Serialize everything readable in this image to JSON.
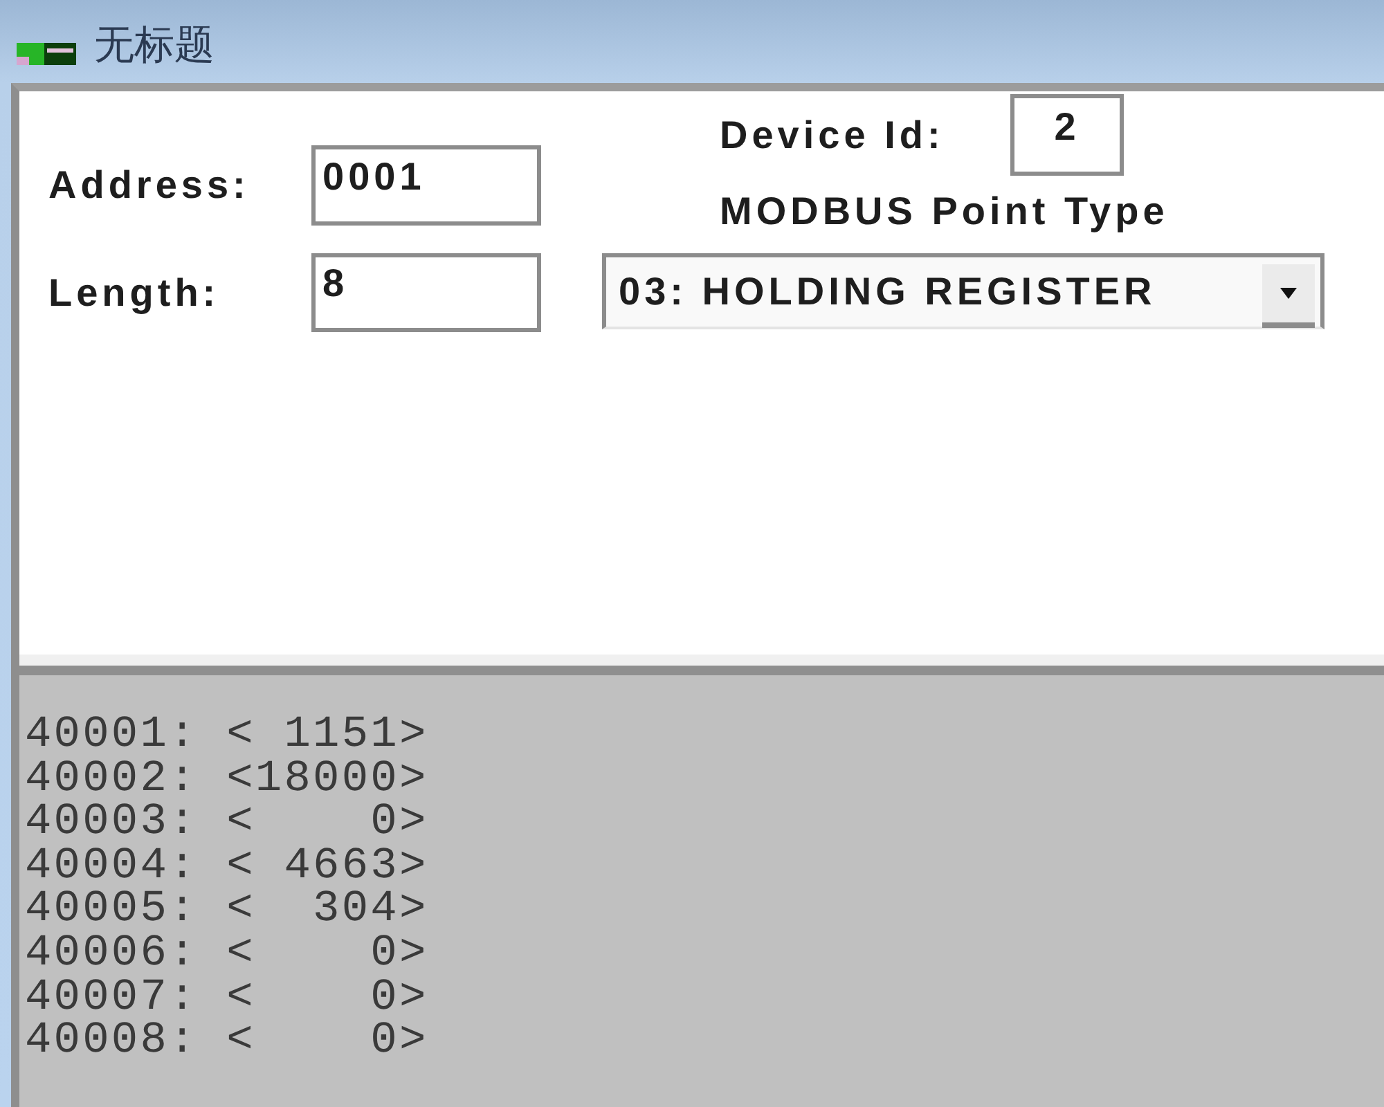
{
  "window": {
    "title": "无标题"
  },
  "form": {
    "address": {
      "label": "Address:",
      "value": "0001"
    },
    "length": {
      "label": "Length:",
      "value": "8"
    },
    "device_id": {
      "label": "Device Id:",
      "value": "2"
    },
    "point_type": {
      "label": "MODBUS Point Type",
      "value": "03: HOLDING REGISTER"
    }
  },
  "output": {
    "lines": [
      "40001: < 1151>",
      "40002: <18000>",
      "40003: <    0>",
      "40004: < 4663>",
      "40005: <  304>",
      "40006: <    0>",
      "40007: <    0>",
      "40008: <    0>"
    ]
  }
}
